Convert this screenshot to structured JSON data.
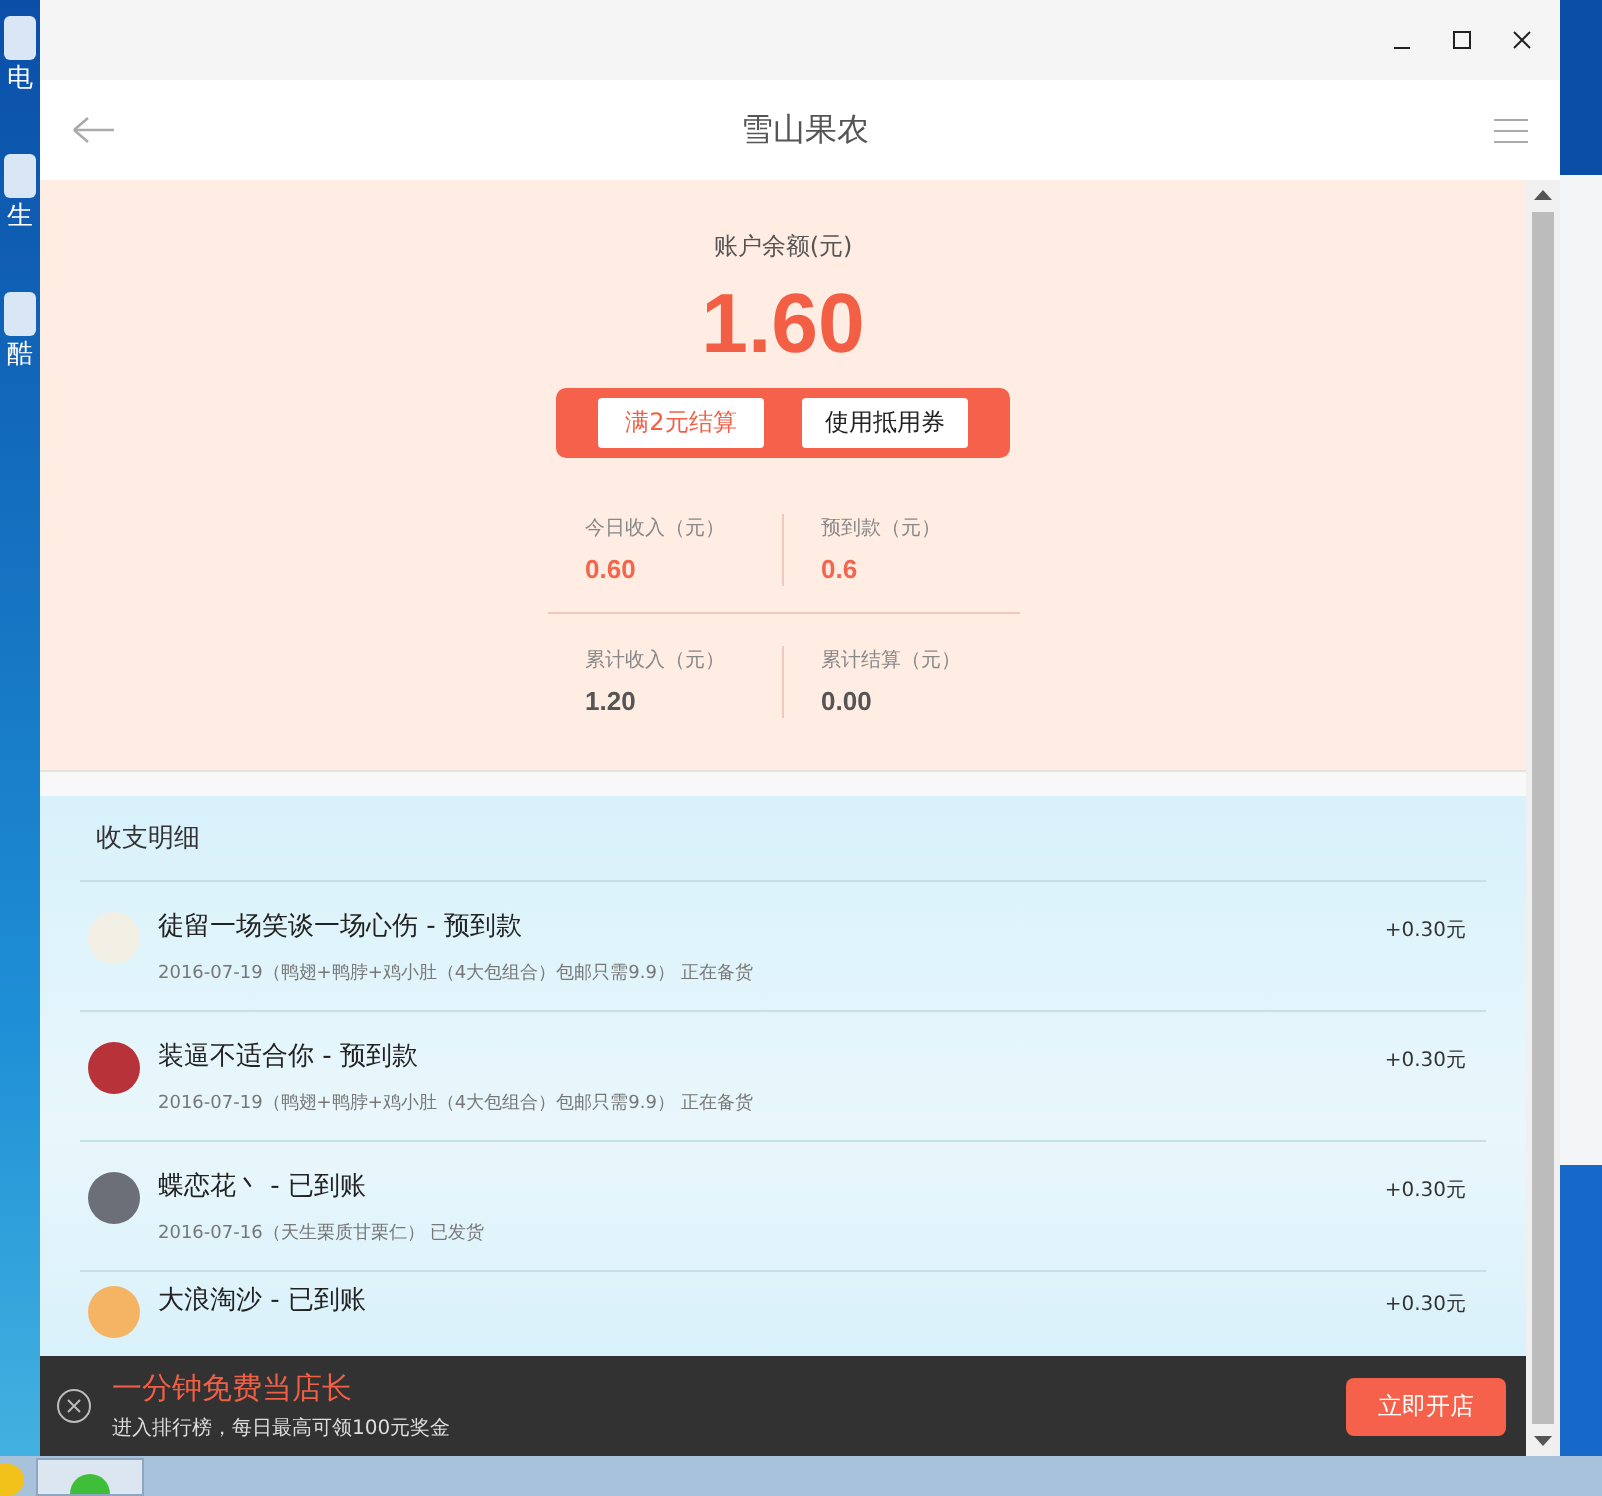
{
  "desktop_icons": [
    {
      "label": "电"
    },
    {
      "label": "生"
    },
    {
      "label": "酷"
    }
  ],
  "header": {
    "title": "雪山果农"
  },
  "balance": {
    "label": "账户余额(元)",
    "amount": "1.60",
    "buttons": [
      {
        "label": "满2元结算",
        "kind": "primary"
      },
      {
        "label": "使用抵用券",
        "kind": "plain"
      }
    ]
  },
  "stats": [
    {
      "label": "今日收入（元）",
      "value": "0.60",
      "highlight": true
    },
    {
      "label": "预到款（元）",
      "value": "0.6",
      "highlight": true
    },
    {
      "label": "累计收入（元）",
      "value": "1.20",
      "highlight": false
    },
    {
      "label": "累计结算（元）",
      "value": "0.00",
      "highlight": false
    }
  ],
  "details": {
    "title": "收支明细",
    "rows": [
      {
        "title": "徒留一场笑谈一场心伤 - 预到款",
        "sub": "2016-07-19（鸭翅+鸭脖+鸡小肚（4大包组合）包邮只需9.9） 正在备货",
        "amount": "+0.30元",
        "color": "#f2efe4"
      },
      {
        "title": "装逼不适合你 - 预到款",
        "sub": "2016-07-19（鸭翅+鸭脖+鸡小肚（4大包组合）包邮只需9.9） 正在备货",
        "amount": "+0.30元",
        "color": "#b8323a"
      },
      {
        "title": "蝶恋花丶 - 已到账",
        "sub": "2016-07-16（天生栗质甘栗仁） 已发货",
        "amount": "+0.30元",
        "color": "#6d6f78"
      },
      {
        "title": "大浪淘沙 - 已到账",
        "amount": "+0.30元",
        "color": "#f4b463"
      }
    ]
  },
  "banner": {
    "title": "一分钟免费当店长",
    "subtitle": "进入排行榜，每日最高可领100元奖金",
    "button": "立即开店"
  }
}
